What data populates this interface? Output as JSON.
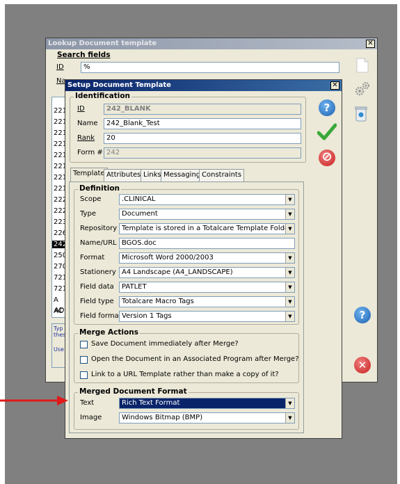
{
  "back_window": {
    "title": "Lookup Document template",
    "search_group_label": "Search fields",
    "id_label": "ID",
    "id_value": "%",
    "name_label_fragment": "Na",
    "list_items": [
      "221",
      "221",
      "221",
      "221",
      "221",
      "221",
      "221",
      "221",
      "222",
      "222",
      "223",
      "226",
      "242",
      "250",
      "270",
      "721",
      "721",
      "A",
      "AC",
      "AD"
    ],
    "hint_lines": [
      "Typ",
      "thes",
      "Use"
    ]
  },
  "dialog": {
    "title": "Setup Document Template",
    "identification": {
      "group_label": "Identification",
      "id_label": "ID",
      "id_value": "242_BLANK",
      "name_label": "Name",
      "name_value": "242_Blank_Test",
      "rank_label": "Rank",
      "rank_value": "20",
      "form_label": "Form #",
      "form_value": "242"
    },
    "tabs": [
      "Template",
      "Attributes",
      "Links",
      "Messaging",
      "Constraints"
    ],
    "definition": {
      "group_label": "Definition",
      "rows": [
        {
          "label": "Scope",
          "value": ".CLINICAL"
        },
        {
          "label": "Type",
          "value": "Document"
        },
        {
          "label": "Repository",
          "value": "Template is stored in a Totalcare Template Folder"
        },
        {
          "label": "Name/URL",
          "value": "BGOS.doc"
        },
        {
          "label": "Format",
          "value": "Microsoft Word 2000/2003"
        },
        {
          "label": "Stationery",
          "value": "A4 Landscape  (A4_LANDSCAPE)"
        },
        {
          "label": "Field data",
          "value": "PATLET"
        },
        {
          "label": "Field type",
          "value": "Totalcare Macro Tags"
        },
        {
          "label": "Field format",
          "value": "Version 1 Tags"
        }
      ]
    },
    "merge_actions": {
      "group_label": "Merge Actions",
      "options": [
        "Save Document immediately after Merge?",
        "Open the Document in an Associated Program after Merge?",
        "Link to a URL Template rather than make a copy of it?"
      ]
    },
    "merged_format": {
      "group_label": "Merged Document Format",
      "text_label": "Text",
      "text_value": "Rich Text Format",
      "image_label": "Image",
      "image_value": "Windows Bitmap (BMP)"
    }
  },
  "colors": {
    "desktop": "#808080",
    "window_face": "#ece9d8",
    "title_active": "#0a246a",
    "highlight": "#0a246a",
    "arrow": "#e11a1a"
  }
}
